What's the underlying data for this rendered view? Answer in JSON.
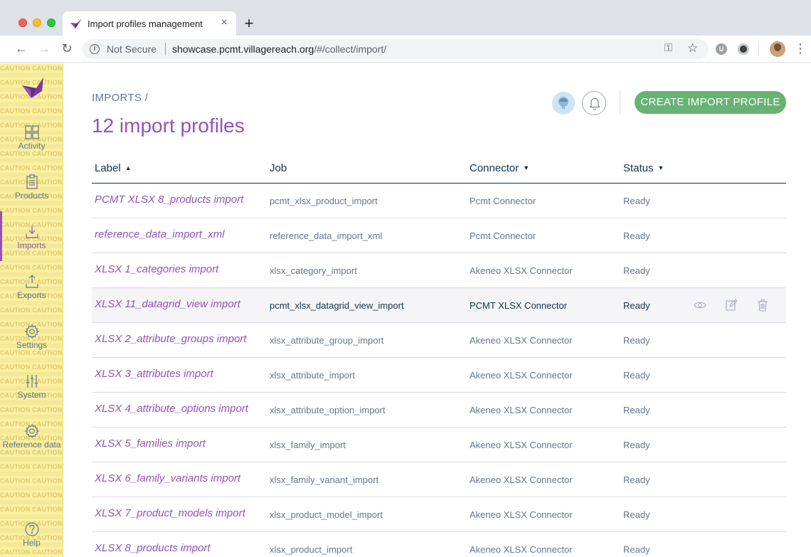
{
  "browser": {
    "tab_title": "Import profiles management",
    "tab_close": "×",
    "new_tab": "+",
    "nav_back": "←",
    "nav_forward": "→",
    "nav_reload": "↻",
    "info": "i",
    "security_label": "Not Secure",
    "url_host": "showcase.pcmt.villagereach.org",
    "url_path": "/#/collect/import/",
    "key_icon": "⚿",
    "star_icon": "☆",
    "extension_u": "U",
    "kebab": "⋮"
  },
  "sidebar": {
    "watermark_text": "CAUTION CAUTION CAUTION",
    "items": [
      {
        "label": "Activity",
        "icon": "dashboard-icon",
        "active": false
      },
      {
        "label": "Products",
        "icon": "clipboard-icon",
        "active": false
      },
      {
        "label": "Imports",
        "icon": "import-icon",
        "active": true
      },
      {
        "label": "Exports",
        "icon": "export-icon",
        "active": false
      },
      {
        "label": "Settings",
        "icon": "gear-icon",
        "active": false
      },
      {
        "label": "System",
        "icon": "sliders-icon",
        "active": false
      },
      {
        "label": "Reference data",
        "icon": "gear-icon",
        "active": false
      },
      {
        "label": "Help",
        "icon": "help-icon",
        "active": false
      }
    ]
  },
  "header": {
    "breadcrumb": "IMPORTS /",
    "title": "12 import profiles",
    "create_button": "CREATE IMPORT PROFILE"
  },
  "grid": {
    "columns": {
      "label": "Label",
      "job": "Job",
      "connector": "Connector",
      "status": "Status"
    },
    "rows": [
      {
        "label": "PCMT XLSX 8_products import",
        "job": "pcmt_xlsx_product_import",
        "connector": "Pcmt Connector",
        "status": "Ready"
      },
      {
        "label": "reference_data_import_xml",
        "job": "reference_data_import_xml",
        "connector": "Pcmt Connector",
        "status": "Ready"
      },
      {
        "label": "XLSX 1_categories import",
        "job": "xlsx_category_import",
        "connector": "Akeneo XLSX Connector",
        "status": "Ready"
      },
      {
        "label": "XLSX 11_datagrid_view import",
        "job": "pcmt_xlsx_datagrid_view_import",
        "connector": "PCMT XLSX Connector",
        "status": "Ready"
      },
      {
        "label": "XLSX 2_attribute_groups import",
        "job": "xlsx_attribute_group_import",
        "connector": "Akeneo XLSX Connector",
        "status": "Ready"
      },
      {
        "label": "XLSX 3_attributes import",
        "job": "xlsx_attribute_import",
        "connector": "Akeneo XLSX Connector",
        "status": "Ready"
      },
      {
        "label": "XLSX 4_attribute_options import",
        "job": "xlsx_attribute_option_import",
        "connector": "Akeneo XLSX Connector",
        "status": "Ready"
      },
      {
        "label": "XLSX 5_families import",
        "job": "xlsx_family_import",
        "connector": "Akeneo XLSX Connector",
        "status": "Ready"
      },
      {
        "label": "XLSX 6_family_variants import",
        "job": "xlsx_family_variant_import",
        "connector": "Akeneo XLSX Connector",
        "status": "Ready"
      },
      {
        "label": "XLSX 7_product_models import",
        "job": "xlsx_product_model_import",
        "connector": "Akeneo XLSX Connector",
        "status": "Ready"
      },
      {
        "label": "XLSX 8_products import",
        "job": "xlsx_product_import",
        "connector": "Akeneo XLSX Connector",
        "status": "Ready"
      }
    ],
    "hovered_row_actions": [
      "view-icon",
      "edit-icon",
      "delete-icon"
    ]
  },
  "colors": {
    "accent_purple": "#9452ba",
    "create_green": "#67b373",
    "sidebar_yellow": "#f9f0a3",
    "text_dark": "#11324d",
    "text_grey": "#67768a"
  }
}
